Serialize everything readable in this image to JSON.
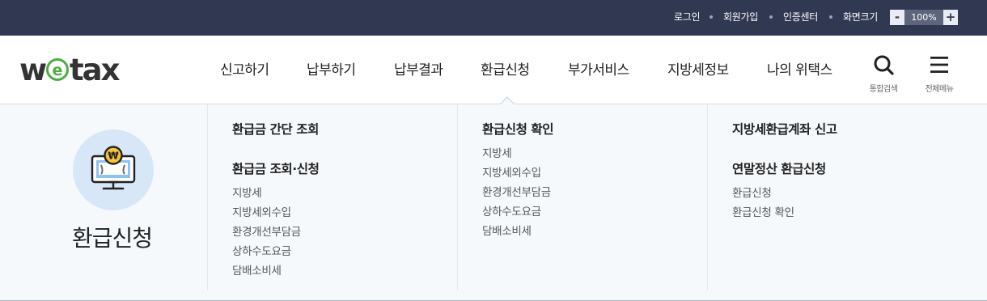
{
  "utility": {
    "login": "로그인",
    "signup": "회원가입",
    "cert_center": "인증센터",
    "zoom_label": "화면크기",
    "zoom_minus": "-",
    "zoom_value": "100%",
    "zoom_plus": "+"
  },
  "logo": {
    "text_before": "w",
    "text_e": "e",
    "text_after": "tax",
    "accent": "#4cae3f"
  },
  "nav": {
    "items": [
      "신고하기",
      "납부하기",
      "납부결과",
      "환급신청",
      "부가서비스",
      "지방세정보",
      "나의 위택스"
    ],
    "active": "환급신청"
  },
  "header_buttons": {
    "search": {
      "label": "통합검색",
      "icon": "search-icon"
    },
    "menu": {
      "label": "전체메뉴",
      "icon": "hamburger-menu-icon"
    }
  },
  "mega": {
    "title": "환급신청",
    "icon": "refund-monitor-icon",
    "columns": [
      {
        "groups": [
          {
            "heading": "환급금 간단 조회",
            "items": []
          },
          {
            "heading": "환급금 조회·신청",
            "items": [
              "지방세",
              "지방세외수입",
              "환경개선부담금",
              "상하수도요금",
              "담배소비세"
            ]
          }
        ]
      },
      {
        "groups": [
          {
            "heading": "환급신청 확인",
            "items": [
              "지방세",
              "지방세외수입",
              "환경개선부담금",
              "상하수도요금",
              "담배소비세"
            ]
          }
        ]
      },
      {
        "groups": [
          {
            "heading": "지방세환급계좌 신고",
            "items": []
          },
          {
            "heading": "연말정산 환급신청",
            "items": [
              "환급신청",
              "환급신청 확인"
            ]
          }
        ]
      }
    ]
  },
  "colors": {
    "topbar": "#313852",
    "accent_green": "#4cae3f",
    "panel_bg": "#f6f9fc",
    "coin": "#f7c33a"
  }
}
